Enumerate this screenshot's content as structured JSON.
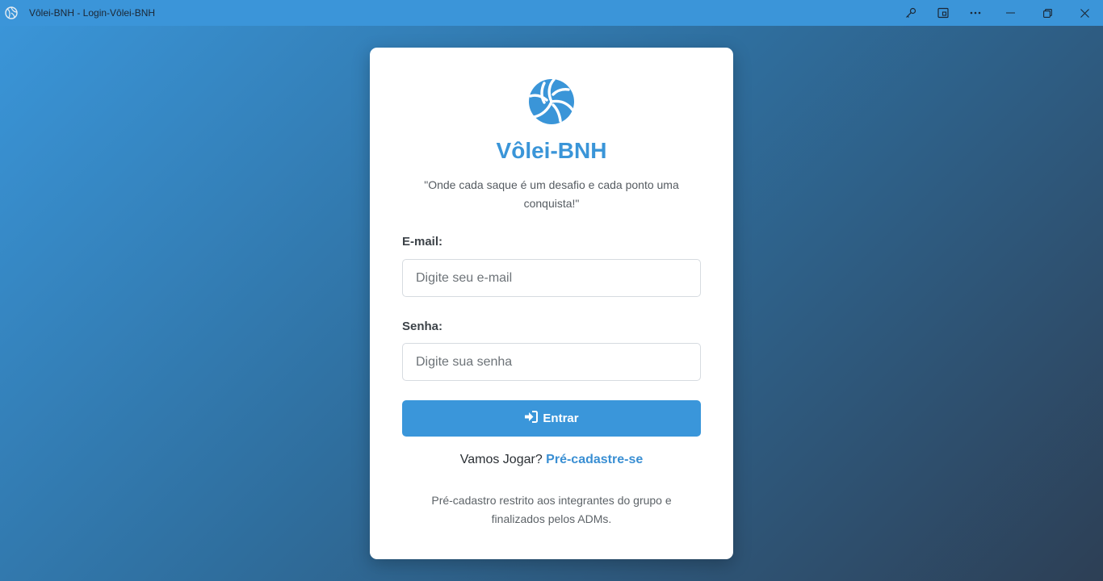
{
  "window": {
    "title": "Vôlei-BNH - Login-Vôlei-BNH",
    "icons": [
      "volleyball-icon",
      "key-icon",
      "cast-icon",
      "more-icon",
      "minimize-icon",
      "restore-icon",
      "close-icon"
    ]
  },
  "colors": {
    "titlebar": "#3b95d9",
    "accent": "#3a95d8",
    "background_start": "#3a95d8",
    "background_end": "#2d3f55"
  },
  "login": {
    "brand": "Vôlei-BNH",
    "tagline": "\"Onde cada saque é um desafio e cada ponto uma conquista!\"",
    "email_label": "E-mail:",
    "email_placeholder": "Digite seu e-mail",
    "email_value": "",
    "password_label": "Senha:",
    "password_placeholder": "Digite sua senha",
    "password_value": "",
    "submit_label": "Entrar",
    "submit_icon": "sign-in-icon",
    "signup_prompt": "Vamos Jogar?",
    "signup_link": "Pré-cadastre-se",
    "note": "Pré-cadastro restrito aos integrantes do grupo e finalizados pelos ADMs."
  }
}
